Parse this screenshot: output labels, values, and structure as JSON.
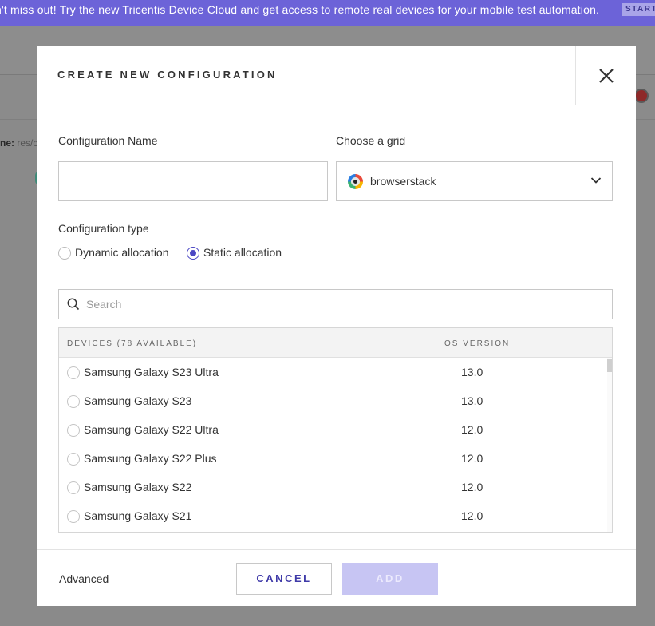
{
  "banner": {
    "message": "n't miss out! Try the new Tricentis Device Cloud and get access to remote real devices for your mobile test automation.",
    "start_label": "START"
  },
  "background": {
    "name_label": "ne:",
    "name_value": "res/c"
  },
  "modal": {
    "title": "CREATE NEW CONFIGURATION",
    "config_name_label": "Configuration Name",
    "config_name_value": "",
    "grid_label": "Choose a grid",
    "grid_value": "browserstack",
    "config_type_label": "Configuration type",
    "allocation_options": [
      {
        "label": "Dynamic allocation",
        "selected": false
      },
      {
        "label": "Static allocation",
        "selected": true
      }
    ],
    "search_placeholder": "Search",
    "table": {
      "devices_header": "DEVICES (78 AVAILABLE)",
      "os_header": "OS VERSION",
      "rows": [
        {
          "device": "Samsung Galaxy S23 Ultra",
          "os": "13.0"
        },
        {
          "device": "Samsung Galaxy S23",
          "os": "13.0"
        },
        {
          "device": "Samsung Galaxy S22 Ultra",
          "os": "12.0"
        },
        {
          "device": "Samsung Galaxy S22 Plus",
          "os": "12.0"
        },
        {
          "device": "Samsung Galaxy S22",
          "os": "12.0"
        },
        {
          "device": "Samsung Galaxy S21",
          "os": "12.0"
        }
      ]
    },
    "footer": {
      "advanced_label": "Advanced",
      "cancel_label": "CANCEL",
      "add_label": "ADD"
    }
  },
  "colors": {
    "banner": "#6c63d8",
    "accent": "#4b47c4",
    "add_button_disabled": "#c7c5f3"
  }
}
